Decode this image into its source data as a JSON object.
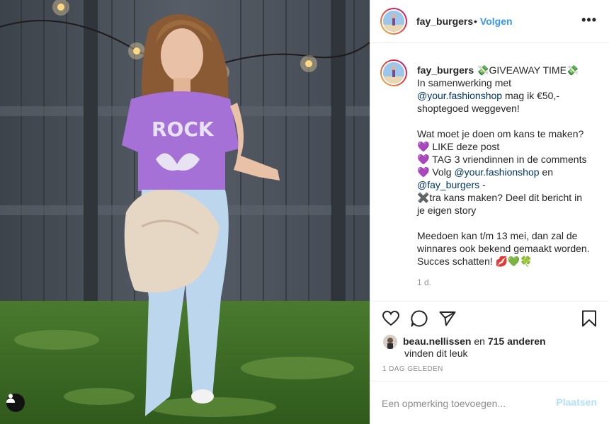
{
  "header": {
    "username": "fay_burgers",
    "separator": "•",
    "follow_label": "Volgen",
    "more_label": "•••"
  },
  "caption": {
    "username": "fay_burgers",
    "text_1": " 💸GIVEAWAY TIME💸\nIn samenwerking met\n",
    "mention_1": "@your.fashionshop",
    "text_2": " mag ik €50,-\nshoptegoed weggeven!\n\nWat moet je doen om kans te maken?\n💜 LIKE deze post\n💜 TAG 3 vriendinnen in de comments\n💜 Volg ",
    "mention_2": "@your.fashionshop",
    "text_3": " en\n",
    "mention_3": "@fay_burgers",
    "text_4": " -\n✖️tra kans maken? Deel dit bericht in\nje eigen story\n\nMeedoen kan t/m 13 mei, dan zal de\nwinnares ook bekend gemaakt worden.\nSucces schatten! 💋💚🍀",
    "time": "1 d."
  },
  "actions": {
    "like_icon": "heart-icon",
    "comment_icon": "comment-icon",
    "share_icon": "paper-plane-icon",
    "save_icon": "bookmark-icon"
  },
  "likes": {
    "user": "beau.nellissen",
    "middle": " en ",
    "count": "715 anderen",
    "line2": "vinden dit leuk"
  },
  "date_label": "1 DAG GELEDEN",
  "comment": {
    "placeholder": "Een opmerking toevoegen...",
    "post_label": "Plaatsen"
  },
  "colors": {
    "accent": "#3897f0",
    "post_disabled": "#b2dffc",
    "muted": "#8e8e8e",
    "mention": "#003569"
  }
}
